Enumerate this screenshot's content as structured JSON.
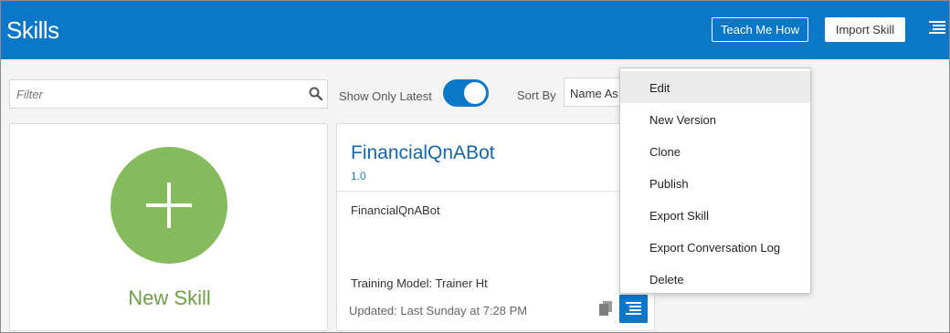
{
  "header": {
    "title": "Skills",
    "teach_label": "Teach Me How",
    "import_label": "Import Skill",
    "menu_icon": "hamburger-menu-icon"
  },
  "toolbar": {
    "filter_placeholder": "Filter",
    "show_latest_label": "Show Only Latest",
    "show_latest_on": true,
    "sort_by_label": "Sort By",
    "sort_value": "Name As"
  },
  "new_skill_card": {
    "label": "New Skill"
  },
  "skill_card": {
    "name": "FinancialQnABot",
    "version": "1.0",
    "description": "FinancialQnABot",
    "training_model": "Training Model: Trainer Ht",
    "updated": "Updated: Last Sunday at 7:28 PM"
  },
  "context_menu": {
    "items": [
      {
        "label": "Edit"
      },
      {
        "label": "New Version"
      },
      {
        "label": "Clone"
      },
      {
        "label": "Publish"
      },
      {
        "label": "Export Skill"
      },
      {
        "label": "Export Conversation Log"
      },
      {
        "label": "Delete"
      }
    ],
    "active_index": 0
  },
  "colors": {
    "brand_blue": "#0a77c9",
    "new_skill_green": "#86bb5d"
  }
}
